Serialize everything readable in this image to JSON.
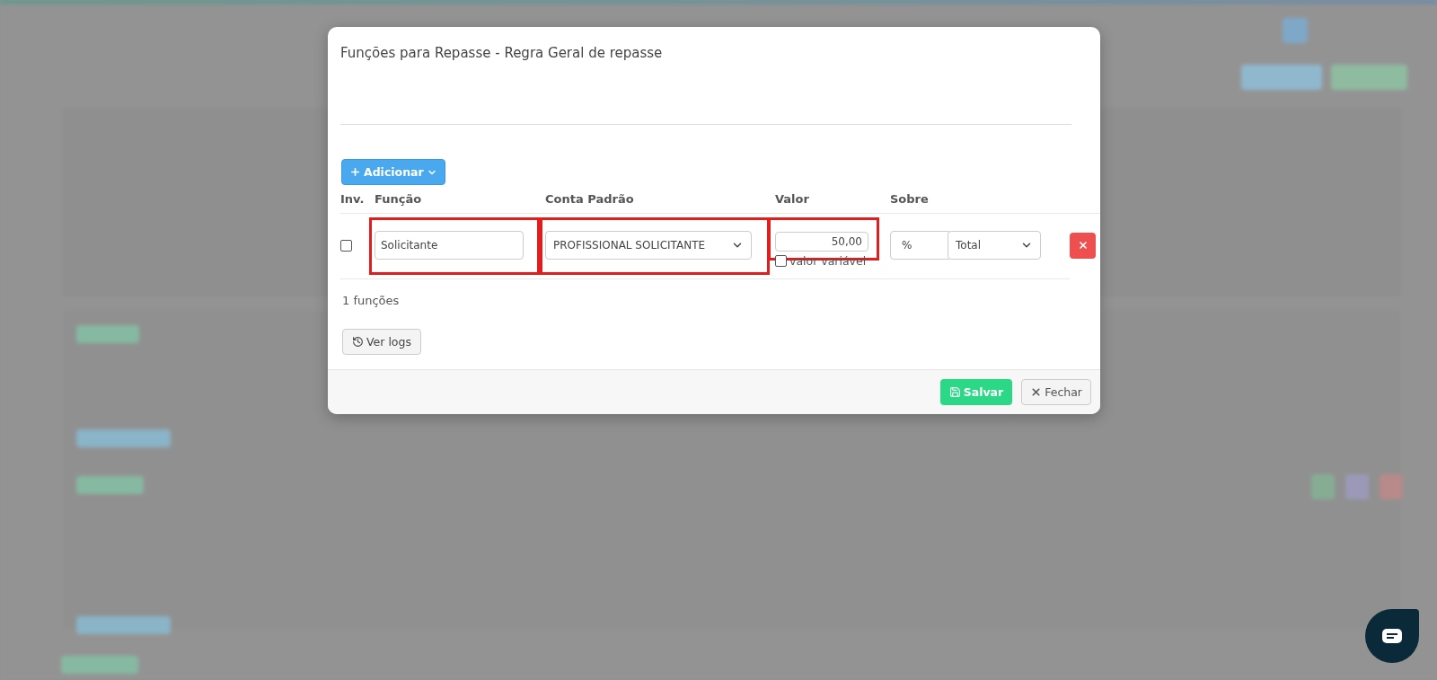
{
  "modal": {
    "title": "Funções para Repasse - Regra Geral de repasse",
    "add_button": "Adicionar",
    "columns": [
      "Inv.",
      "Função",
      "Conta Padrão",
      "Valor",
      "Sobre"
    ],
    "rows": [
      {
        "inverted": false,
        "function": "Solicitante",
        "account": "PROFISSIONAL SOLICITANTE",
        "value": "50,00",
        "variable": false,
        "variable_label": "valor variável",
        "unit": "%",
        "base": "Total",
        "function_marked": true,
        "account_marked": true,
        "value_marked": true
      }
    ],
    "count": "1 funções",
    "logs_button": "Ver logs",
    "save_button": "Salvar",
    "close_button": "Fechar"
  }
}
